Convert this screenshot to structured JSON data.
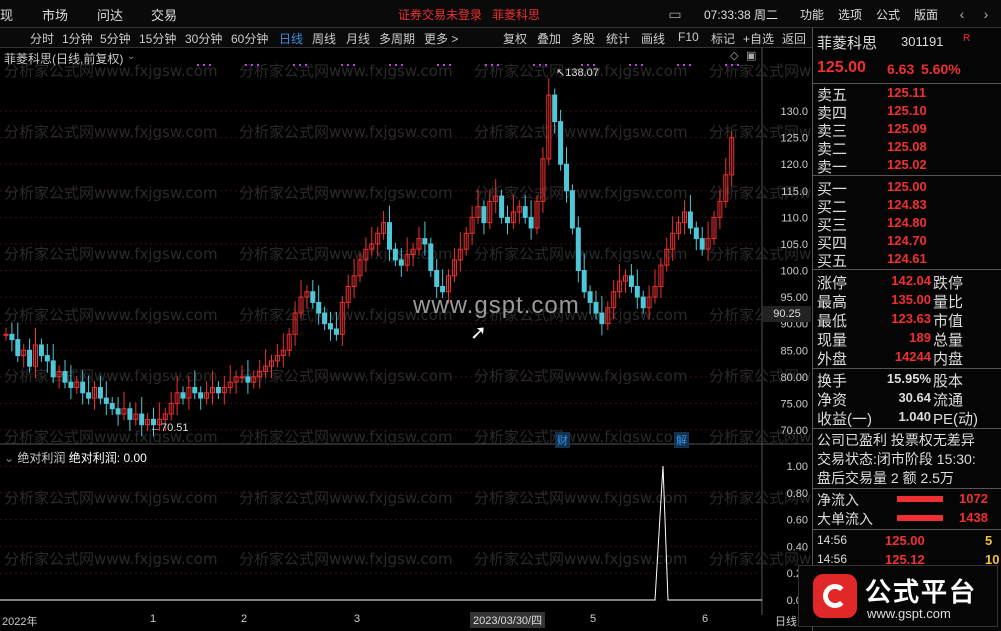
{
  "top_menu": {
    "partial_left": "现",
    "items": [
      "市场",
      "问达",
      "交易"
    ],
    "warning": "证券交易未登录",
    "stock_name": "菲菱科思",
    "clock": "07:33:38 周二",
    "right_items": [
      "功能",
      "选项",
      "公式",
      "版面"
    ]
  },
  "timeframes": {
    "items": [
      "分时",
      "1分钟",
      "5分钟",
      "15分钟",
      "30分钟",
      "60分钟",
      "日线",
      "周线",
      "月线",
      "多周期",
      "更多 >"
    ],
    "active": "日线"
  },
  "tools": [
    "复权",
    "叠加",
    "多股",
    "统计",
    "画线",
    "F10",
    "标记",
    "+自选",
    "返回"
  ],
  "chart": {
    "title": "菲菱科思(日线,前复权)",
    "high_label": "138.07",
    "low_label": "70.51",
    "y_ticks": [
      "130.0",
      "125.0",
      "120.0",
      "115.0",
      "110.0",
      "105.0",
      "100.0",
      "95.00",
      "90.00",
      "85.00",
      "80.00",
      "75.00",
      "70.00"
    ],
    "crosshair_price": "90.25",
    "markers": [
      "财",
      "解"
    ],
    "watermark_center": "www.gspt.com",
    "watermark_text": "分析家公式网www.fxjgsw.com"
  },
  "indicator": {
    "name": "绝对利润",
    "label": "绝对利润:",
    "value": "0.00",
    "y_ticks": [
      "1.00",
      "0.80",
      "0.60",
      "0.40",
      "0.20",
      "0.00"
    ]
  },
  "date_axis": {
    "labels": [
      "2022年",
      "1",
      "2",
      "3",
      "2023/03/30/四",
      "5",
      "6"
    ],
    "right": "日线"
  },
  "quote": {
    "name": "菲菱科思",
    "code": "301191",
    "badge": "R",
    "price": "125.00",
    "change": "6.63",
    "pct": "5.60%",
    "asks": [
      {
        "label": "卖五",
        "price": "125.11"
      },
      {
        "label": "卖四",
        "price": "125.10"
      },
      {
        "label": "卖三",
        "price": "125.09"
      },
      {
        "label": "卖二",
        "price": "125.08"
      },
      {
        "label": "卖一",
        "price": "125.02"
      }
    ],
    "bids": [
      {
        "label": "买一",
        "price": "125.00"
      },
      {
        "label": "买二",
        "price": "124.83"
      },
      {
        "label": "买三",
        "price": "124.80"
      },
      {
        "label": "买四",
        "price": "124.70"
      },
      {
        "label": "买五",
        "price": "124.61"
      }
    ],
    "stats": [
      {
        "l1": "涨停",
        "v1": "142.04",
        "l2": "跌停"
      },
      {
        "l1": "最高",
        "v1": "135.00",
        "l2": "量比"
      },
      {
        "l1": "最低",
        "v1": "123.63",
        "l2": "市值"
      },
      {
        "l1": "现量",
        "v1": "189",
        "l2": "总量"
      },
      {
        "l1": "外盘",
        "v1": "14244",
        "l2": "内盘"
      }
    ],
    "stats2": [
      {
        "l1": "换手",
        "v1": "15.95%",
        "l2": "股本"
      },
      {
        "l1": "净资",
        "v1": "30.64",
        "l2": "流通"
      },
      {
        "l1": "收益(一)",
        "v1": "1.040",
        "l2": "PE(动)"
      }
    ],
    "info": [
      "公司已盈利 投票权无差异",
      "交易状态:闭市阶段 15:30:",
      "盘后交易量 2 额 2.5万"
    ],
    "flows": [
      {
        "label": "净流入",
        "value": "1072"
      },
      {
        "label": "大单流入",
        "value": "1438"
      }
    ],
    "ticks": [
      {
        "time": "14:56",
        "price": "125.00",
        "vol": "5"
      },
      {
        "time": "14:56",
        "price": "125.12",
        "vol": "10"
      }
    ]
  },
  "logo": {
    "title": "公式平台",
    "url": "www.gspt.com"
  }
}
